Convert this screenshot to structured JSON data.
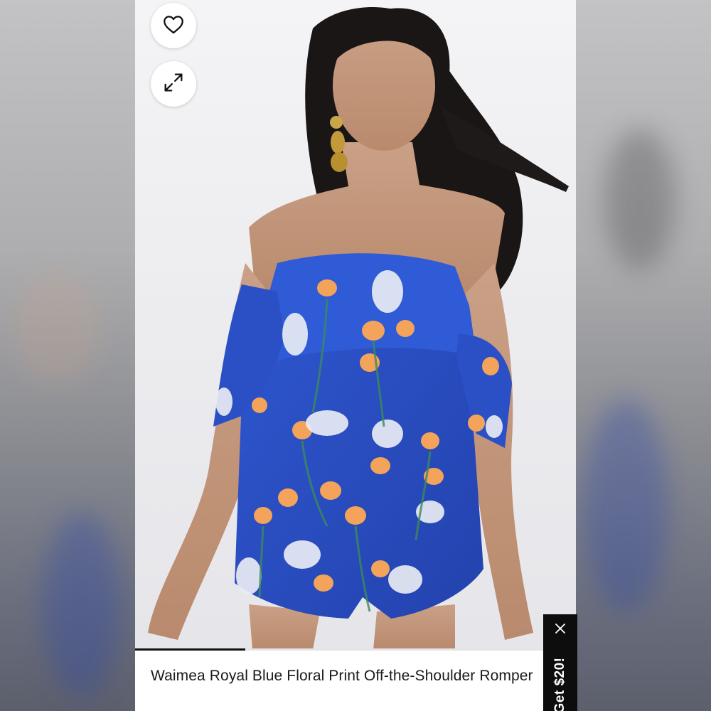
{
  "product": {
    "title": "Waimea Royal Blue Floral Print Off-the-Shoulder Romper"
  },
  "actions": {
    "like_icon": "heart-icon",
    "expand_icon": "expand-arrows-icon"
  },
  "gallery": {
    "progress": 0.25
  },
  "promo": {
    "label": "Get $20!",
    "close_icon": "close-icon"
  },
  "colors": {
    "fabric": "#2b4fc4",
    "accent": "#0d0d0d"
  }
}
